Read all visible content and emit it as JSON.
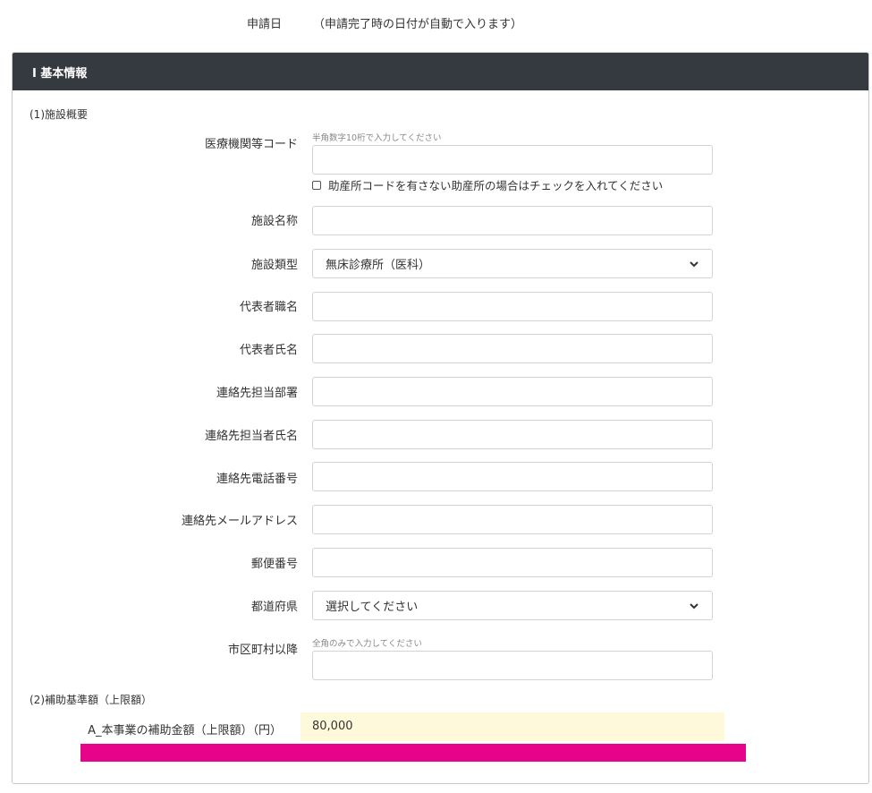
{
  "application_date": {
    "label": "申請日",
    "value": "（申請完了時の日付が自動で入ります）"
  },
  "panel": {
    "title": "Ⅰ 基本情報"
  },
  "sections": {
    "facility_overview": "(1)施設概要",
    "subsidy_base": "(2)補助基準額（上限額）"
  },
  "fields": {
    "medical_code": {
      "label": "医療機関等コード",
      "hint": "半角数字10桁で入力してください",
      "value": "",
      "no_code_checkbox_label": "助産所コードを有さない助産所の場合はチェックを入れてください",
      "no_code_checked": false
    },
    "facility_name": {
      "label": "施設名称",
      "value": ""
    },
    "facility_type": {
      "label": "施設類型",
      "selected": "無床診療所（医科）"
    },
    "rep_title": {
      "label": "代表者職名",
      "value": ""
    },
    "rep_name": {
      "label": "代表者氏名",
      "value": ""
    },
    "contact_dept": {
      "label": "連絡先担当部署",
      "value": ""
    },
    "contact_person": {
      "label": "連絡先担当者氏名",
      "value": ""
    },
    "contact_phone": {
      "label": "連絡先電話番号",
      "value": ""
    },
    "contact_email": {
      "label": "連絡先メールアドレス",
      "value": ""
    },
    "postal_code": {
      "label": "郵便番号",
      "value": ""
    },
    "prefecture": {
      "label": "都道府県",
      "selected": "選択してください"
    },
    "city_address": {
      "label": "市区町村以降",
      "hint": "全角のみで入力してください",
      "value": ""
    }
  },
  "subsidy": {
    "label": "A_本事業の補助金額（上限額）（円）",
    "value": "80,000"
  },
  "icons": {
    "select_arrow": "chevron-down-icon"
  },
  "colors": {
    "header_bg": "#343a40",
    "amount_bg": "#fff9dc",
    "accent_bar": "#e8048a"
  }
}
